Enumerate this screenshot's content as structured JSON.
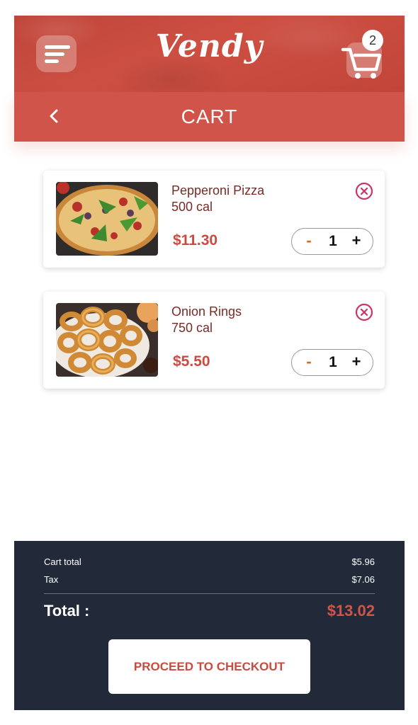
{
  "header": {
    "logo_text": "Vendy",
    "menu_icon": "hamburger-menu-icon",
    "cart_icon": "shopping-cart-icon",
    "cart_count": "2"
  },
  "titlebar": {
    "back_icon": "chevron-left-icon",
    "title": "CART"
  },
  "cart": {
    "items": [
      {
        "name": "Pepperoni Pizza",
        "calories": "500 cal",
        "price": "$11.30",
        "quantity": "1",
        "minus": "-",
        "plus": "+",
        "remove_icon": "close-circle-icon"
      },
      {
        "name": "Onion Rings",
        "calories": "750 cal",
        "price": "$5.50",
        "quantity": "1",
        "minus": "-",
        "plus": "+",
        "remove_icon": "close-circle-icon"
      }
    ]
  },
  "summary": {
    "cart_total_label": "Cart total",
    "cart_total_value": "$5.96",
    "tax_label": "Tax",
    "tax_value": "$7.06",
    "total_label": "Total :",
    "total_value": "$13.02",
    "checkout_label": "PROCEED TO CHECKOUT"
  },
  "colors": {
    "brand_red": "#d0544a",
    "header_red": "#c7473b",
    "footer_navy": "#222a39",
    "remove_icon": "#cc3366",
    "minus": "#d46a2a"
  }
}
